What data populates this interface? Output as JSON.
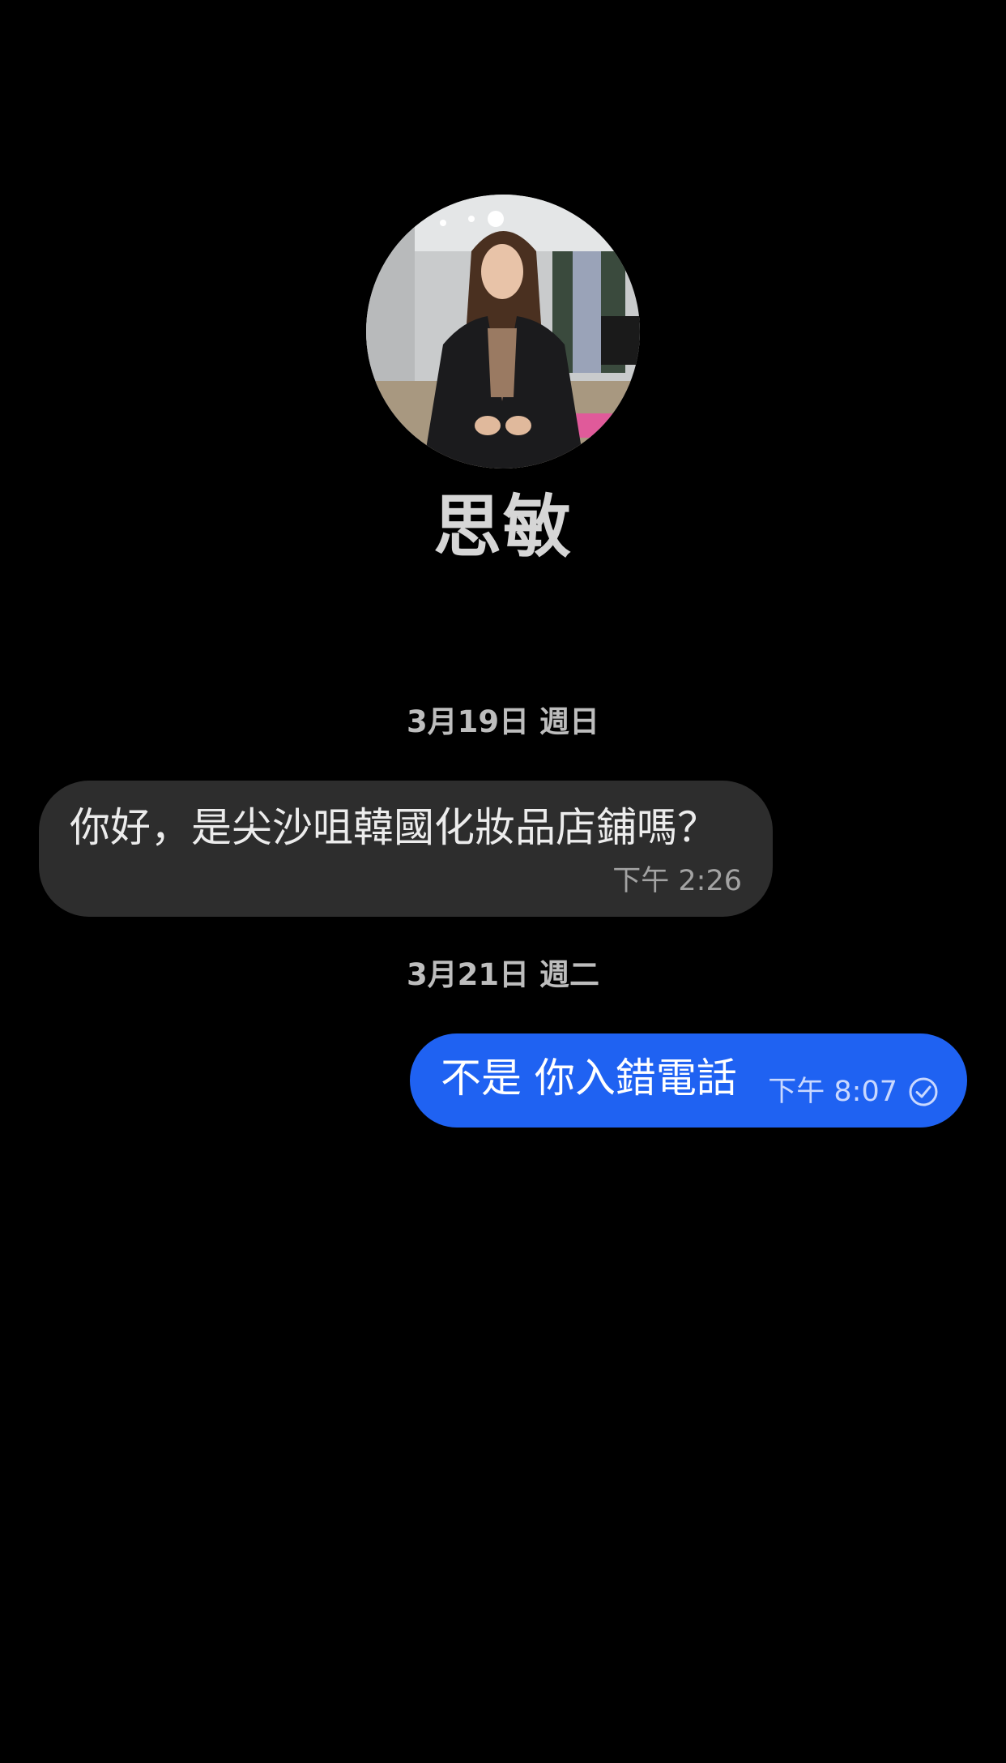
{
  "contact": {
    "name": "思敏"
  },
  "conversation": {
    "date_separators": [
      "3月19日 週日",
      "3月21日 週二"
    ],
    "messages": [
      {
        "direction": "incoming",
        "text": "你好，是尖沙咀韓國化妝品店鋪嗎？",
        "time": "下午 2:26"
      },
      {
        "direction": "outgoing",
        "text": "不是 你入錯電話",
        "time": "下午 8:07",
        "status_icon": "check-circle-icon"
      }
    ]
  },
  "colors": {
    "background": "#000000",
    "incoming_bubble": "#2d2d2d",
    "outgoing_bubble": "#1f62f2",
    "name_text": "#d6d6d6",
    "date_text": "#bdbdbd"
  }
}
